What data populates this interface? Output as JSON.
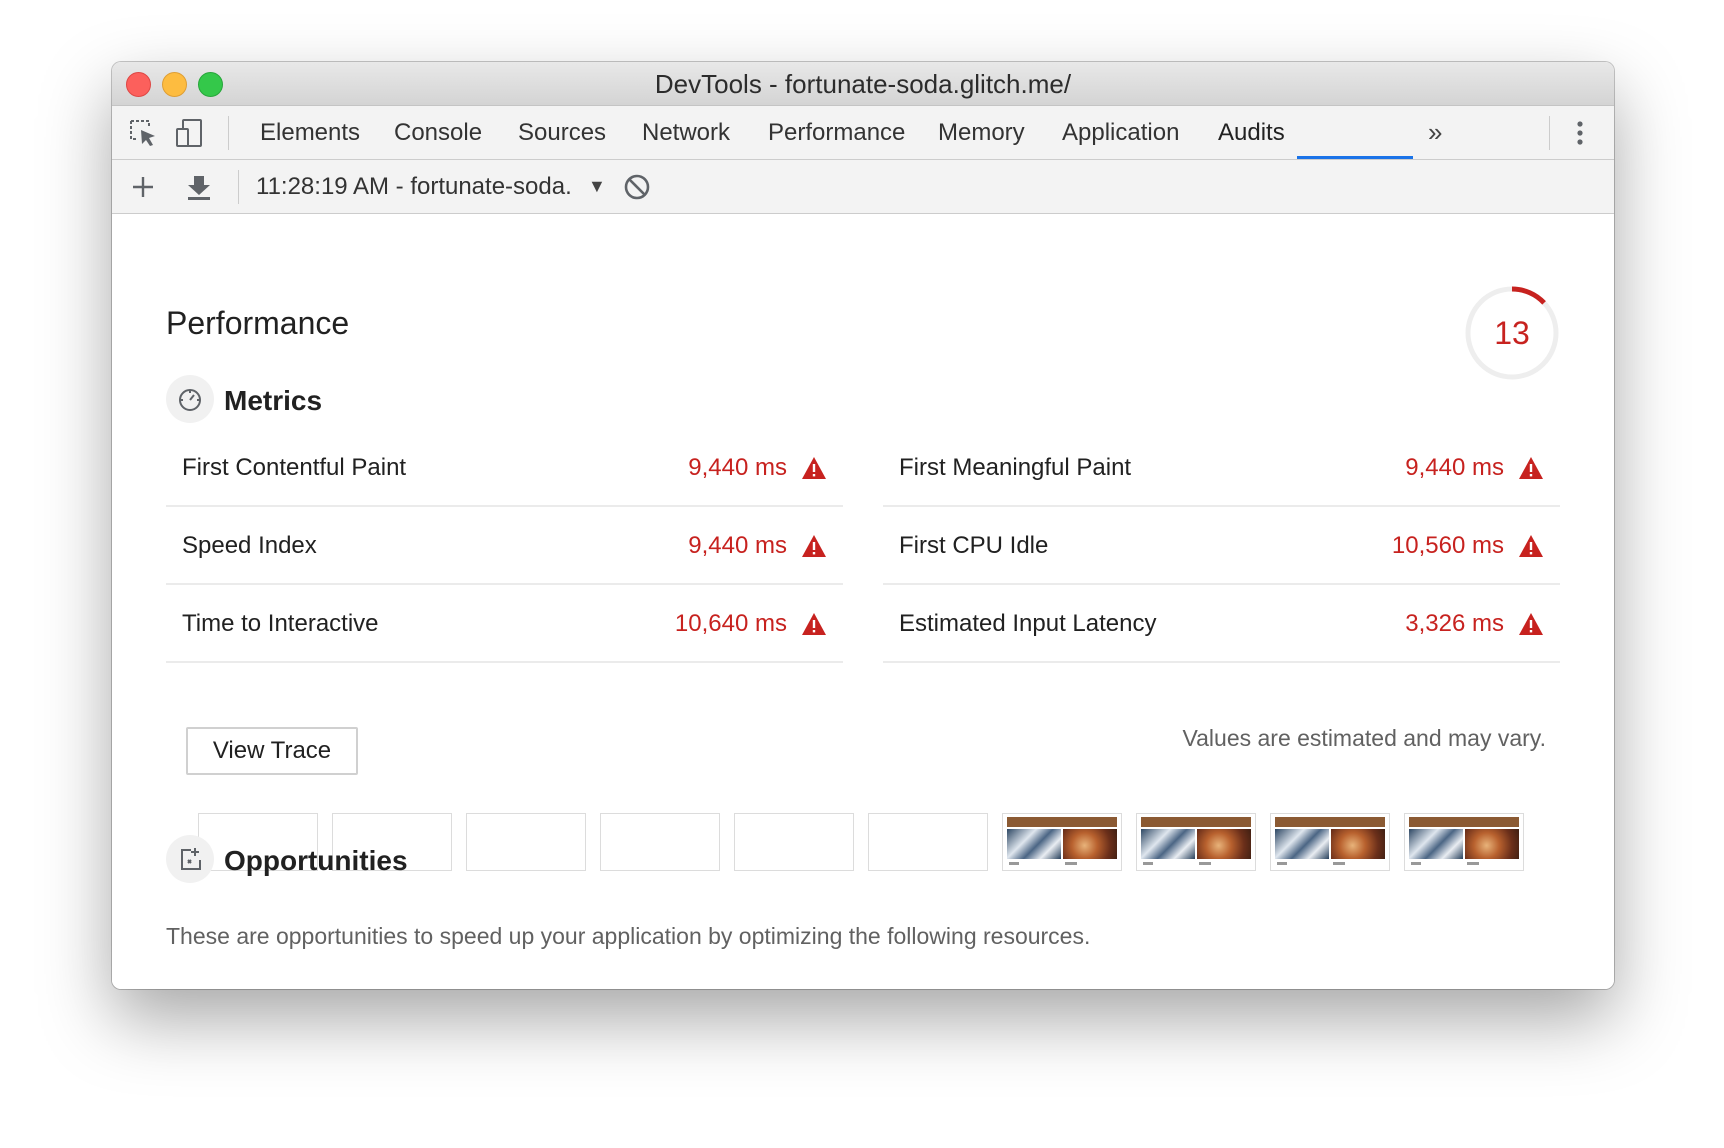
{
  "window": {
    "title": "DevTools - fortunate-soda.glitch.me/"
  },
  "tabs": [
    {
      "label": "Elements"
    },
    {
      "label": "Console"
    },
    {
      "label": "Sources"
    },
    {
      "label": "Network"
    },
    {
      "label": "Performance"
    },
    {
      "label": "Memory"
    },
    {
      "label": "Application"
    },
    {
      "label": "Audits",
      "active": true
    }
  ],
  "toolbar": {
    "report_selector": "11:28:19 AM - fortunate-soda."
  },
  "performance": {
    "title": "Performance",
    "score": "13",
    "score_fraction": 0.13,
    "score_color": "#c7221f",
    "metrics_title": "Metrics",
    "metrics": [
      {
        "label": "First Contentful Paint",
        "value": "9,440 ms"
      },
      {
        "label": "First Meaningful Paint",
        "value": "9,440 ms"
      },
      {
        "label": "Speed Index",
        "value": "9,440 ms"
      },
      {
        "label": "First CPU Idle",
        "value": "10,560 ms"
      },
      {
        "label": "Time to Interactive",
        "value": "10,640 ms"
      },
      {
        "label": "Estimated Input Latency",
        "value": "3,326 ms"
      }
    ],
    "view_trace_label": "View Trace",
    "disclaimer": "Values are estimated and may vary.",
    "filmstrip_frames": [
      "blank",
      "blank",
      "blank",
      "blank",
      "blank",
      "blank",
      "loaded",
      "loaded",
      "loaded",
      "loaded"
    ],
    "opportunities_title": "Opportunities",
    "opportunities_description": "These are opportunities to speed up your application by optimizing the following resources."
  },
  "colors": {
    "fail": "#c7221f",
    "active_tab_underline": "#1a73e8"
  }
}
